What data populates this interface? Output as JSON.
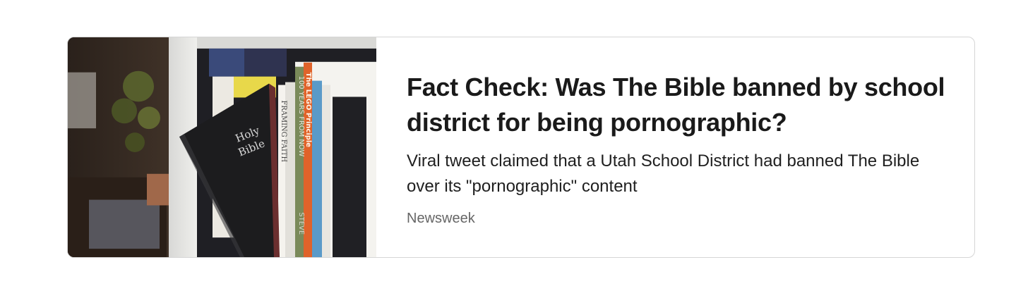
{
  "card": {
    "title": "Fact Check: Was The Bible banned by school district for being pornographic?",
    "description": "Viral tweet claimed that a Utah School District had banned The Bible over its \"pornographic\" content",
    "source": "Newsweek"
  },
  "thumbnail": {
    "bible_cover_text_line1": "Holy",
    "bible_cover_text_line2": "Bible",
    "spine_text_1": "100 YEARS FROM NOW",
    "spine_text_2": "FRAMING FAITH",
    "spine_text_3": "The LEGO Principle",
    "spine_text_4": "STEVE",
    "colors": {
      "accent_orange": "#e0632a",
      "bible_black": "#1c1c1e"
    }
  }
}
